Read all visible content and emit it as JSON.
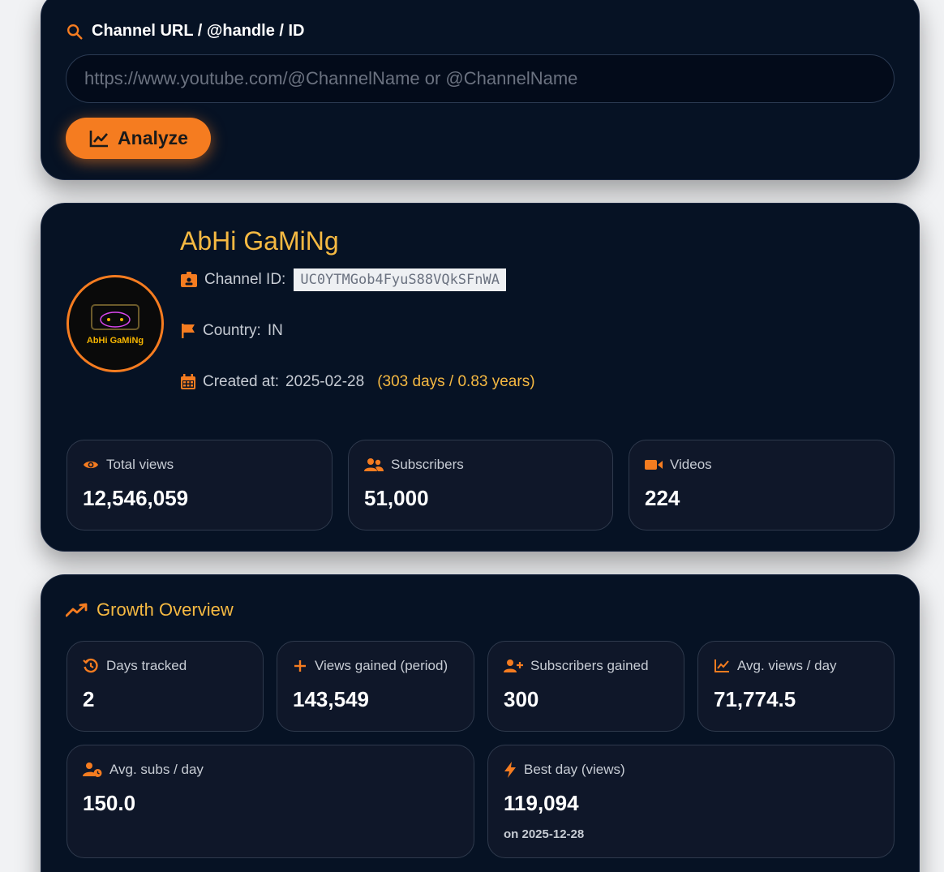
{
  "search": {
    "label": "Channel URL / @handle / ID",
    "placeholder": "https://www.youtube.com/@ChannelName or @ChannelName",
    "value": "",
    "analyze_label": "Analyze"
  },
  "channel": {
    "name": "AbHi GaMiNg",
    "avatar_text": "AbHi GaMiNg",
    "id_label": "Channel ID:",
    "id_value": "UC0YTMGob4FyuS88VQkSFnWA",
    "country_label": "Country:",
    "country_value": "IN",
    "created_label": "Created at:",
    "created_value": "2025-02-28",
    "age_text": "(303 days / 0.83 years)",
    "stats": [
      {
        "label": "Total views",
        "value": "12,546,059",
        "icon": "eye-icon"
      },
      {
        "label": "Subscribers",
        "value": "51,000",
        "icon": "users-icon"
      },
      {
        "label": "Videos",
        "value": "224",
        "icon": "video-icon"
      }
    ]
  },
  "growth": {
    "title": "Growth Overview",
    "stats": [
      {
        "label": "Days tracked",
        "value": "2",
        "icon": "history-icon"
      },
      {
        "label": "Views gained (period)",
        "value": "143,549",
        "icon": "plus-icon"
      },
      {
        "label": "Subscribers gained",
        "value": "300",
        "icon": "user-plus-icon"
      },
      {
        "label": "Avg. views / day",
        "value": "71,774.5",
        "icon": "line-chart-icon"
      },
      {
        "label": "Avg. subs / day",
        "value": "150.0",
        "icon": "user-clock-icon"
      },
      {
        "label": "Best day (views)",
        "value": "119,094",
        "sub": "on 2025-12-28",
        "icon": "bolt-icon"
      }
    ]
  },
  "colors": {
    "accent": "#f57c20",
    "gold": "#f5b942",
    "card_bg": "#061224",
    "stat_bg": "#0f1729"
  }
}
